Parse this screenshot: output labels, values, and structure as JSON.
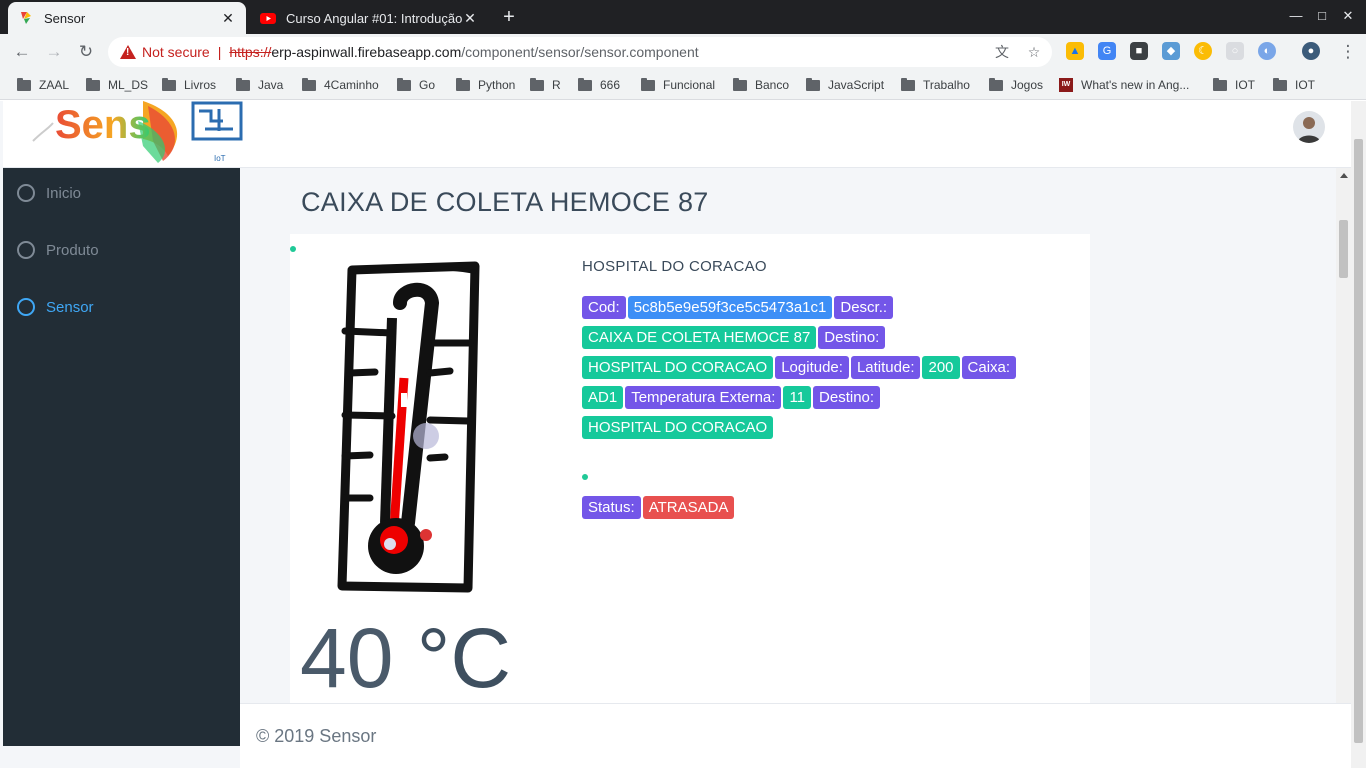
{
  "browser": {
    "tabs": [
      {
        "title": "Sensor",
        "active": true
      },
      {
        "title": "Curso Angular #01: Introdução",
        "active": false
      }
    ],
    "security_label": "Not secure",
    "url_scheme": "https://",
    "url_host": "erp-aspinwall.firebaseapp.com",
    "url_path": "/component/sensor/sensor.component",
    "bookmarks": [
      "ZAAL",
      "ML_DS",
      "Livros",
      "Java",
      "4Caminho",
      "Go",
      "Python",
      "R",
      "666",
      "Funcional",
      "Banco",
      "JavaScript",
      "Trabalho",
      "Jogos",
      "What's new in Ang...",
      "IOT",
      "IOT"
    ]
  },
  "app": {
    "logo_text": "Sens",
    "logo_sub": "IoT",
    "sidebar": [
      {
        "label": "Inicio",
        "active": false
      },
      {
        "label": "Produto",
        "active": false
      },
      {
        "label": "Sensor",
        "active": true
      }
    ],
    "page_title": "CAIXA DE COLETA HEMOCE 87",
    "card": {
      "hospital": "HOSPITAL DO CORACAO",
      "temperature_value": "40",
      "temperature_unit": "°C",
      "chip_rows": [
        [
          {
            "text": "Cod:",
            "kind": "label"
          },
          {
            "text": "5c8b5e9e59f3ce5c5473a1c1",
            "kind": "value-blue"
          },
          {
            "text": "Descr.:",
            "kind": "label"
          }
        ],
        [
          {
            "text": "CAIXA DE COLETA HEMOCE 87",
            "kind": "value-green"
          },
          {
            "text": "Destino:",
            "kind": "label"
          }
        ],
        [
          {
            "text": "HOSPITAL DO CORACAO",
            "kind": "value-green"
          },
          {
            "text": "Logitude:",
            "kind": "label"
          },
          {
            "text": "Latitude:",
            "kind": "label"
          },
          {
            "text": "200",
            "kind": "value-green"
          },
          {
            "text": "Caixa:",
            "kind": "label"
          }
        ],
        [
          {
            "text": "AD1",
            "kind": "value-green"
          },
          {
            "text": "Temperatura Externa:",
            "kind": "label"
          },
          {
            "text": "11",
            "kind": "value-green"
          },
          {
            "text": "Destino:",
            "kind": "label"
          }
        ],
        [
          {
            "text": "HOSPITAL DO CORACAO",
            "kind": "value-green"
          }
        ]
      ],
      "status_label": "Status:",
      "status_value": "ATRASADA"
    },
    "footer": "© 2019 Sensor"
  },
  "colors": {
    "sidebar_bg": "#222d36",
    "accent": "#3fa7f5",
    "chip_label": "#7356e8",
    "chip_blue": "#3d8ff6",
    "chip_green": "#16c99b",
    "chip_red": "#e8504f"
  }
}
